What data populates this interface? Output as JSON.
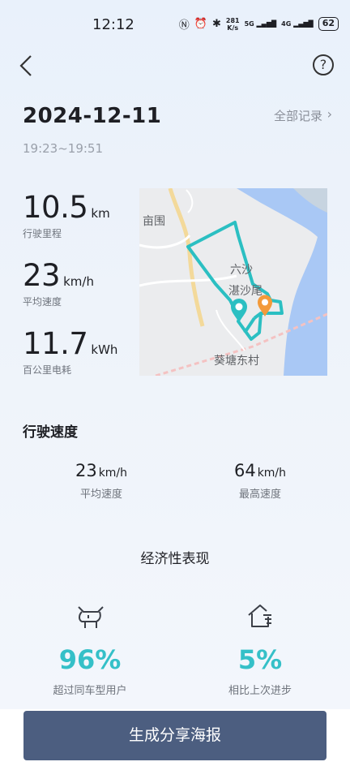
{
  "status_bar": {
    "time": "12:12",
    "net_speed_top": "281",
    "net_speed_bottom": "K/s",
    "signal_1": "5G",
    "signal_2": "4G",
    "battery": "62"
  },
  "header": {
    "date": "2024-12-11",
    "time_range": "19:23~19:51",
    "all_records_label": "全部记录",
    "help_symbol": "?"
  },
  "stats": [
    {
      "value": "10.5",
      "unit": "km",
      "label": "行驶里程"
    },
    {
      "value": "23",
      "unit": "km/h",
      "label": "平均速度"
    },
    {
      "value": "11.7",
      "unit": "kWh",
      "label": "百公里电耗"
    }
  ],
  "map": {
    "labels": [
      "亩围",
      "六沙",
      "湛沙尾",
      "葵塘东村"
    ],
    "route_color": "#2bbfc2",
    "end_marker_color": "#f39a3a"
  },
  "speed_section": {
    "title": "行驶速度",
    "avg": {
      "value": "23",
      "unit": "km/h",
      "label": "平均速度"
    },
    "max": {
      "value": "64",
      "unit": "km/h",
      "label": "最高速度"
    }
  },
  "economy": {
    "title": "经济性表现",
    "left": {
      "icon": "bull-icon",
      "value": "96%",
      "label": "超过同车型用户"
    },
    "right": {
      "icon": "home-progress-icon",
      "value": "5%",
      "label": "相比上次进步"
    }
  },
  "share_button": {
    "label": "生成分享海报"
  }
}
